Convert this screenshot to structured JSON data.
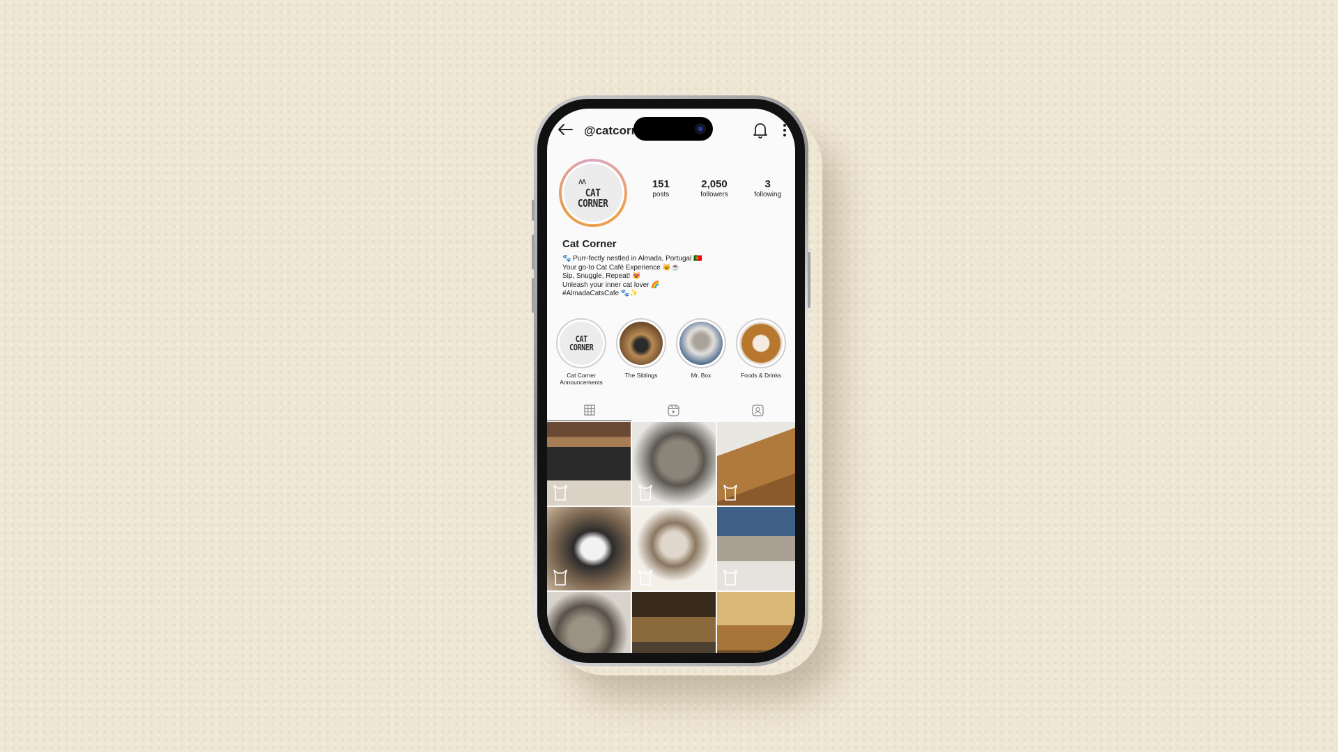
{
  "profile": {
    "handle": "@catcorn",
    "name": "Cat Corner",
    "avatar_icon": "cat-corner-logo",
    "logo_line1": "CAT",
    "logo_line2": "CORNER",
    "stats": [
      {
        "value": "151",
        "label": "posts"
      },
      {
        "value": "2,050",
        "label": "followers"
      },
      {
        "value": "3",
        "label": "following"
      }
    ],
    "bio": [
      "🐾 Purr-fectly nestled in Almada, Portugal 🇵🇹",
      "Your go-to Cat Café Experience 🐱☕",
      "Sip, Snuggle, Repeat! 😻",
      "Unleash your inner cat lover 🌈",
      "#AlmadaCatsCafe 🐾✨"
    ]
  },
  "highlights": [
    {
      "label": "Cat Corner Announcements"
    },
    {
      "label": "The Siblings"
    },
    {
      "label": "Mr. Box"
    },
    {
      "label": "Foods & Drinks"
    }
  ],
  "tabs": [
    {
      "name": "grid-icon"
    },
    {
      "name": "reels-icon"
    },
    {
      "name": "tagged-icon"
    }
  ],
  "colors": {
    "background": "#efe6d3",
    "screen": "#fafafa",
    "text": "#222222",
    "story_ring_start": "#d9a6c6",
    "story_ring_end": "#f0a050"
  },
  "posts": [
    {
      "bg": "linear-gradient(180deg,#6a4a35 0 18%,#a67c55 18% 30%,#2a2a2a 30% 70%,#d9d2c5 70%)"
    },
    {
      "bg": "radial-gradient(circle at 55% 45%,#8b8579 0 28%,#5c5851 40%,#e8e6e2 70%)"
    },
    {
      "bg": "linear-gradient(160deg,#e9e7e2 0 30%,#b07a3c 30% 70%,#8a5a2b 70%)"
    },
    {
      "bg": "radial-gradient(ellipse at 55% 50%,#f2f2f2 0 18%,#2c2c2c 30%,#7a6550 60%,#c7b59a)"
    },
    {
      "bg": "radial-gradient(circle at 50% 45%,#e0d7cc 0 20%,#8a7760 35%,#f3efe9 60%)"
    },
    {
      "bg": "linear-gradient(180deg,#3e5f86 0 35%,#a99f92 35% 65%,#e6e3de 65%)"
    },
    {
      "bg": "radial-gradient(circle at 45% 50%,#9c9284 0 25%,#5a524a 45%,#d8d3cc 70%)"
    },
    {
      "bg": "linear-gradient(180deg,#3a2a1c 0 30%,#8a6a3c 30% 60%,#4d4030 60%)"
    },
    {
      "bg": "linear-gradient(180deg,#d9b877 0 40%,#a7743a 40% 70%,#6d4d2a 70%)"
    }
  ]
}
